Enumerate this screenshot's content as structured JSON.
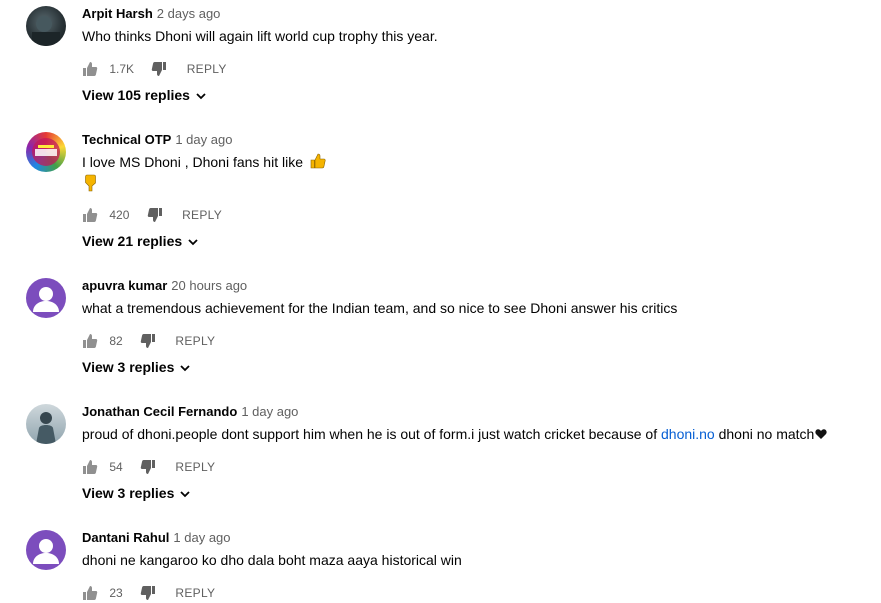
{
  "colors": {
    "purple_avatar": "#7c4dbd",
    "link": "#065fd4",
    "muted": "#606060"
  },
  "comments": [
    {
      "author": "Arpit Harsh",
      "time": "2 days ago",
      "text": "Who thinks Dhoni will again lift world cup trophy this year.",
      "likes": "1.7K",
      "reply_label": "REPLY",
      "view_replies": "View 105 replies",
      "avatar": "photo-dark"
    },
    {
      "author": "Technical OTP",
      "time": "1 day ago",
      "text": "I love MS Dhoni , Dhoni fans hit like",
      "likes": "420",
      "reply_label": "REPLY",
      "view_replies": "View 21 replies",
      "avatar": "logo-colorful"
    },
    {
      "author": "apuvra kumar",
      "time": "20 hours ago",
      "text": "what a tremendous achievement for the Indian team, and so nice to see Dhoni answer his critics",
      "likes": "82",
      "reply_label": "REPLY",
      "view_replies": "View 3 replies",
      "avatar": "default-purple"
    },
    {
      "author": "Jonathan Cecil Fernando",
      "time": "1 day ago",
      "text_before": "proud of dhoni.people dont support him when he is out of form.i just watch cricket because of ",
      "text_link": "dhoni.no",
      "text_after": " dhoni no match",
      "likes": "54",
      "reply_label": "REPLY",
      "view_replies": "View 3 replies",
      "avatar": "photo-person"
    },
    {
      "author": "Dantani Rahul",
      "time": "1 day ago",
      "text": "dhoni ne kangaroo ko dho dala boht maza aaya historical win",
      "likes": "23",
      "reply_label": "REPLY",
      "avatar": "default-purple"
    }
  ]
}
